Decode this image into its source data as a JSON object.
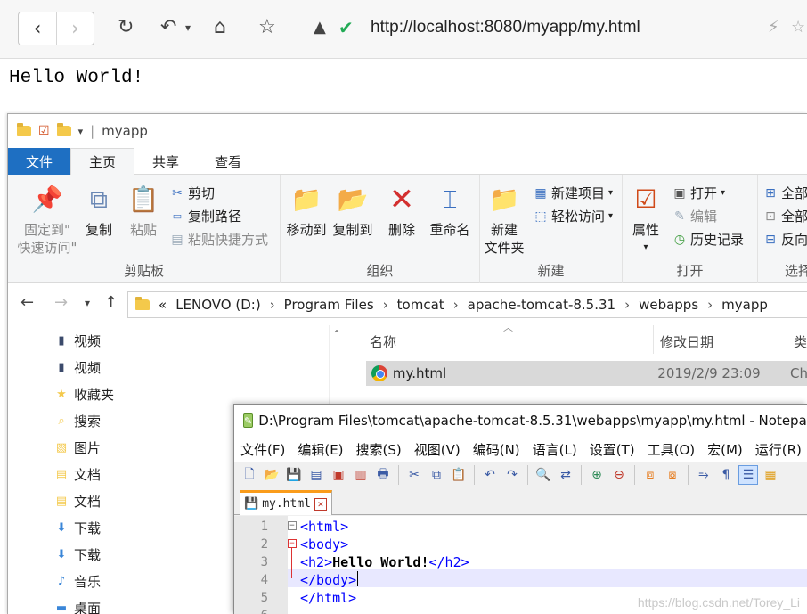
{
  "browser": {
    "url": "http://localhost:8080/myapp/my.html",
    "page_text": "Hello World!",
    "icons": [
      "back-icon",
      "forward-icon",
      "reload-icon",
      "undo-icon",
      "home-icon",
      "star-icon",
      "adblock-icon",
      "shield-check-icon",
      "lightning-icon",
      "star-outline-icon"
    ]
  },
  "explorer": {
    "title": "myapp",
    "tabs": [
      "文件",
      "主页",
      "共享",
      "查看"
    ],
    "ribbon": {
      "clipboard": {
        "label": "剪贴板",
        "pin": "固定到\"",
        "pin2": "快速访问\"",
        "copy": "复制",
        "paste": "粘贴",
        "cut": "剪切",
        "copy_path": "复制路径",
        "paste_shortcut": "粘贴快捷方式"
      },
      "organize": {
        "label": "组织",
        "move_to": "移动到",
        "copy_to": "复制到",
        "delete": "删除",
        "rename": "重命名"
      },
      "new": {
        "label": "新建",
        "new_folder": "新建",
        "new_folder2": "文件夹",
        "new_item": "新建项目",
        "easy_access": "轻松访问"
      },
      "open": {
        "label": "打开",
        "properties": "属性",
        "open": "打开",
        "edit": "编辑",
        "history": "历史记录"
      },
      "select": {
        "label": "选择",
        "all": "全部",
        "none": "全部",
        "invert": "反向"
      }
    },
    "breadcrumb": [
      "LENOVO (D:)",
      "Program Files",
      "tomcat",
      "apache-tomcat-8.5.31",
      "webapps",
      "myapp"
    ],
    "breadcrumb_prefix": "«",
    "nav_items": [
      {
        "label": "视频",
        "icon": "video-folder-icon"
      },
      {
        "label": "视频",
        "icon": "video-folder-icon"
      },
      {
        "label": "收藏夹",
        "icon": "favorites-icon"
      },
      {
        "label": "搜索",
        "icon": "search-folder-icon"
      },
      {
        "label": "图片",
        "icon": "pictures-icon"
      },
      {
        "label": "文档",
        "icon": "documents-icon"
      },
      {
        "label": "文档",
        "icon": "documents-icon"
      },
      {
        "label": "下载",
        "icon": "downloads-icon"
      },
      {
        "label": "下载",
        "icon": "downloads-icon"
      },
      {
        "label": "音乐",
        "icon": "music-icon"
      },
      {
        "label": "桌面",
        "icon": "desktop-icon"
      }
    ],
    "columns": {
      "name": "名称",
      "modified": "修改日期",
      "type": "类"
    },
    "file": {
      "name": "my.html",
      "modified": "2019/2/9 23:09",
      "type": "Ch"
    }
  },
  "notepad": {
    "title": "D:\\Program Files\\tomcat\\apache-tomcat-8.5.31\\webapps\\myapp\\my.html - Notepad++",
    "menu": [
      "文件(F)",
      "编辑(E)",
      "搜索(S)",
      "视图(V)",
      "编码(N)",
      "语言(L)",
      "设置(T)",
      "工具(O)",
      "宏(M)",
      "运行(R)",
      "插"
    ],
    "tab_name": "my.html",
    "lines": [
      {
        "n": "1",
        "code": "<html>"
      },
      {
        "n": "2",
        "code": "<body>"
      },
      {
        "n": "3",
        "code": "<h2>",
        "text": "Hello World!",
        "close": "</h2>"
      },
      {
        "n": "4",
        "code": "</body>"
      },
      {
        "n": "5",
        "code": "</html>"
      },
      {
        "n": "6",
        "code": ""
      }
    ]
  },
  "watermark": "https://blog.csdn.net/Torey_Li"
}
